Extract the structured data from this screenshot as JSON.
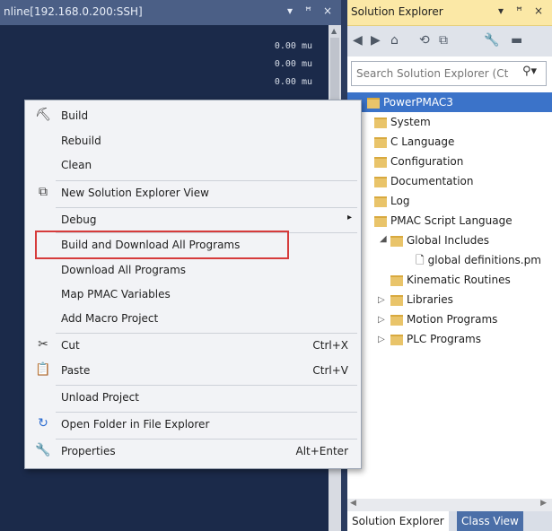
{
  "terminal": {
    "title": "nline[192.168.0.200:SSH]",
    "controls": {
      "dropdown": "▾",
      "pin": "ꟸ",
      "close": "×"
    },
    "readings": [
      "0.00 mu",
      "0.00 mu",
      "0.00 mu"
    ]
  },
  "solution_explorer": {
    "title": "Solution Explorer",
    "controls": {
      "dropdown": "▾",
      "pin": "ꟸ",
      "close": "×"
    },
    "toolbar_icons": [
      "back-icon",
      "forward-icon",
      "home-icon",
      "history-icon",
      "collapse-icon",
      "properties-wrench-icon",
      "dash-icon"
    ],
    "search_placeholder": "Search Solution Explorer (Ct",
    "tree": [
      {
        "label": "PowerPMAC3",
        "level": 0,
        "type": "project",
        "selected": true
      },
      {
        "label": "System",
        "level": 1,
        "type": "folder"
      },
      {
        "label": "C Language",
        "level": 1,
        "type": "folder"
      },
      {
        "label": "Configuration",
        "level": 1,
        "type": "folder"
      },
      {
        "label": "Documentation",
        "level": 1,
        "type": "folder"
      },
      {
        "label": "Log",
        "level": 1,
        "type": "folder"
      },
      {
        "label": "PMAC Script Language",
        "level": 1,
        "type": "folder-open"
      },
      {
        "label": "Global Includes",
        "level": 2,
        "type": "folder-open"
      },
      {
        "label": "global definitions.pm",
        "level": 3,
        "type": "file"
      },
      {
        "label": "Kinematic Routines",
        "level": 2,
        "type": "folder"
      },
      {
        "label": "Libraries",
        "level": 2,
        "type": "folder"
      },
      {
        "label": "Motion Programs",
        "level": 2,
        "type": "folder"
      },
      {
        "label": "PLC Programs",
        "level": 2,
        "type": "folder"
      }
    ],
    "tabs": [
      {
        "label": "Solution Explorer",
        "active": true
      },
      {
        "label": "Class View",
        "active": false
      }
    ]
  },
  "context_menu": {
    "items": [
      {
        "label": "Build",
        "icon": "build-icon",
        "glyph": "⛏"
      },
      {
        "label": "Rebuild"
      },
      {
        "label": "Clean"
      },
      {
        "label": "New Solution Explorer View",
        "icon": "new-view-icon",
        "glyph": "⧉"
      },
      {
        "label": "Debug",
        "submenu": true
      },
      {
        "label": "Build and Download All Programs",
        "highlighted": true
      },
      {
        "label": "Download All Programs"
      },
      {
        "label": "Map PMAC Variables"
      },
      {
        "label": "Add Macro Project"
      },
      {
        "label": "Cut",
        "icon": "scissors-icon",
        "glyph": "✂",
        "shortcut": "Ctrl+X"
      },
      {
        "label": "Paste",
        "icon": "clipboard-icon",
        "glyph": "📋",
        "shortcut": "Ctrl+V"
      },
      {
        "label": "Unload Project"
      },
      {
        "label": "Open Folder in File Explorer",
        "icon": "open-folder-arrow-icon",
        "glyph": "↻"
      },
      {
        "label": "Properties",
        "icon": "wrench-icon",
        "glyph": "🔧",
        "shortcut": "Alt+Enter"
      }
    ]
  },
  "colors": {
    "highlight_box": "#d63b3b",
    "selection": "#3b73c9",
    "title_active": "#fbe8a6"
  }
}
